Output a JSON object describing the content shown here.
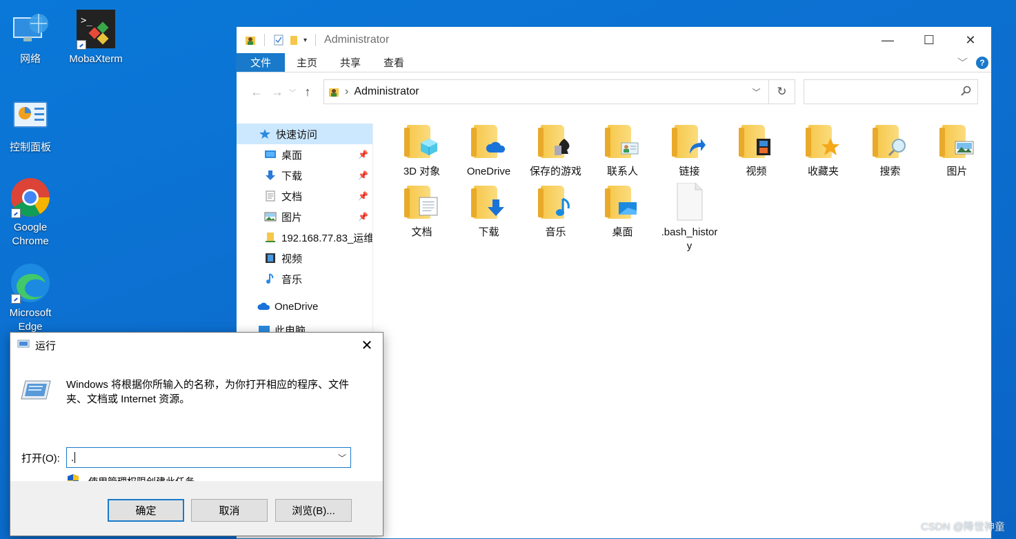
{
  "desktop": {
    "icons": [
      {
        "label": "网络",
        "icon": "network-icon"
      },
      {
        "label": "MobaXterm",
        "icon": "mobaxterm-icon"
      },
      {
        "label": "控制面板",
        "icon": "control-panel-icon"
      },
      {
        "label": "Google Chrome",
        "icon": "chrome-icon"
      },
      {
        "label": "Microsoft Edge",
        "icon": "edge-icon"
      }
    ]
  },
  "explorer": {
    "title": "Administrator",
    "window_buttons": {
      "minimize": "—",
      "maximize": "☐",
      "close": "✕"
    },
    "ribbon": {
      "file": "文件",
      "home": "主页",
      "share": "共享",
      "view": "查看",
      "help": "?"
    },
    "address": {
      "path": "Administrator"
    },
    "sidebar": {
      "quick_access": "快速访问",
      "items": [
        {
          "label": "桌面",
          "pinned": true
        },
        {
          "label": "下载",
          "pinned": true
        },
        {
          "label": "文档",
          "pinned": true
        },
        {
          "label": "图片",
          "pinned": true
        },
        {
          "label": "192.168.77.83_运维",
          "pinned": false
        },
        {
          "label": "视频",
          "pinned": false
        },
        {
          "label": "音乐",
          "pinned": false
        }
      ],
      "onedrive": "OneDrive",
      "this_pc": "此电脑"
    },
    "items": [
      {
        "label": "3D 对象",
        "icon": "3d-objects-folder-icon"
      },
      {
        "label": "OneDrive",
        "icon": "onedrive-folder-icon"
      },
      {
        "label": "保存的游戏",
        "icon": "saved-games-folder-icon"
      },
      {
        "label": "联系人",
        "icon": "contacts-folder-icon"
      },
      {
        "label": "链接",
        "icon": "links-folder-icon"
      },
      {
        "label": "视频",
        "icon": "videos-folder-icon"
      },
      {
        "label": "收藏夹",
        "icon": "favorites-folder-icon"
      },
      {
        "label": "搜索",
        "icon": "searches-folder-icon"
      },
      {
        "label": "图片",
        "icon": "pictures-folder-icon"
      },
      {
        "label": "文档",
        "icon": "documents-folder-icon"
      },
      {
        "label": "下载",
        "icon": "downloads-folder-icon"
      },
      {
        "label": "音乐",
        "icon": "music-folder-icon"
      },
      {
        "label": "桌面",
        "icon": "desktop-folder-icon"
      },
      {
        "label": ".bash_history",
        "icon": "file-icon"
      }
    ]
  },
  "run_dialog": {
    "title": "运行",
    "description": "Windows 将根据你所输入的名称，为你打开相应的程序、文件夹、文档或 Internet 资源。",
    "open_label": "打开(O):",
    "input_value": ".",
    "admin_note": "使用管理权限创建此任务。",
    "ok": "确定",
    "cancel": "取消",
    "browse": "浏览(B)..."
  },
  "watermark": "CSDN @降世神童"
}
